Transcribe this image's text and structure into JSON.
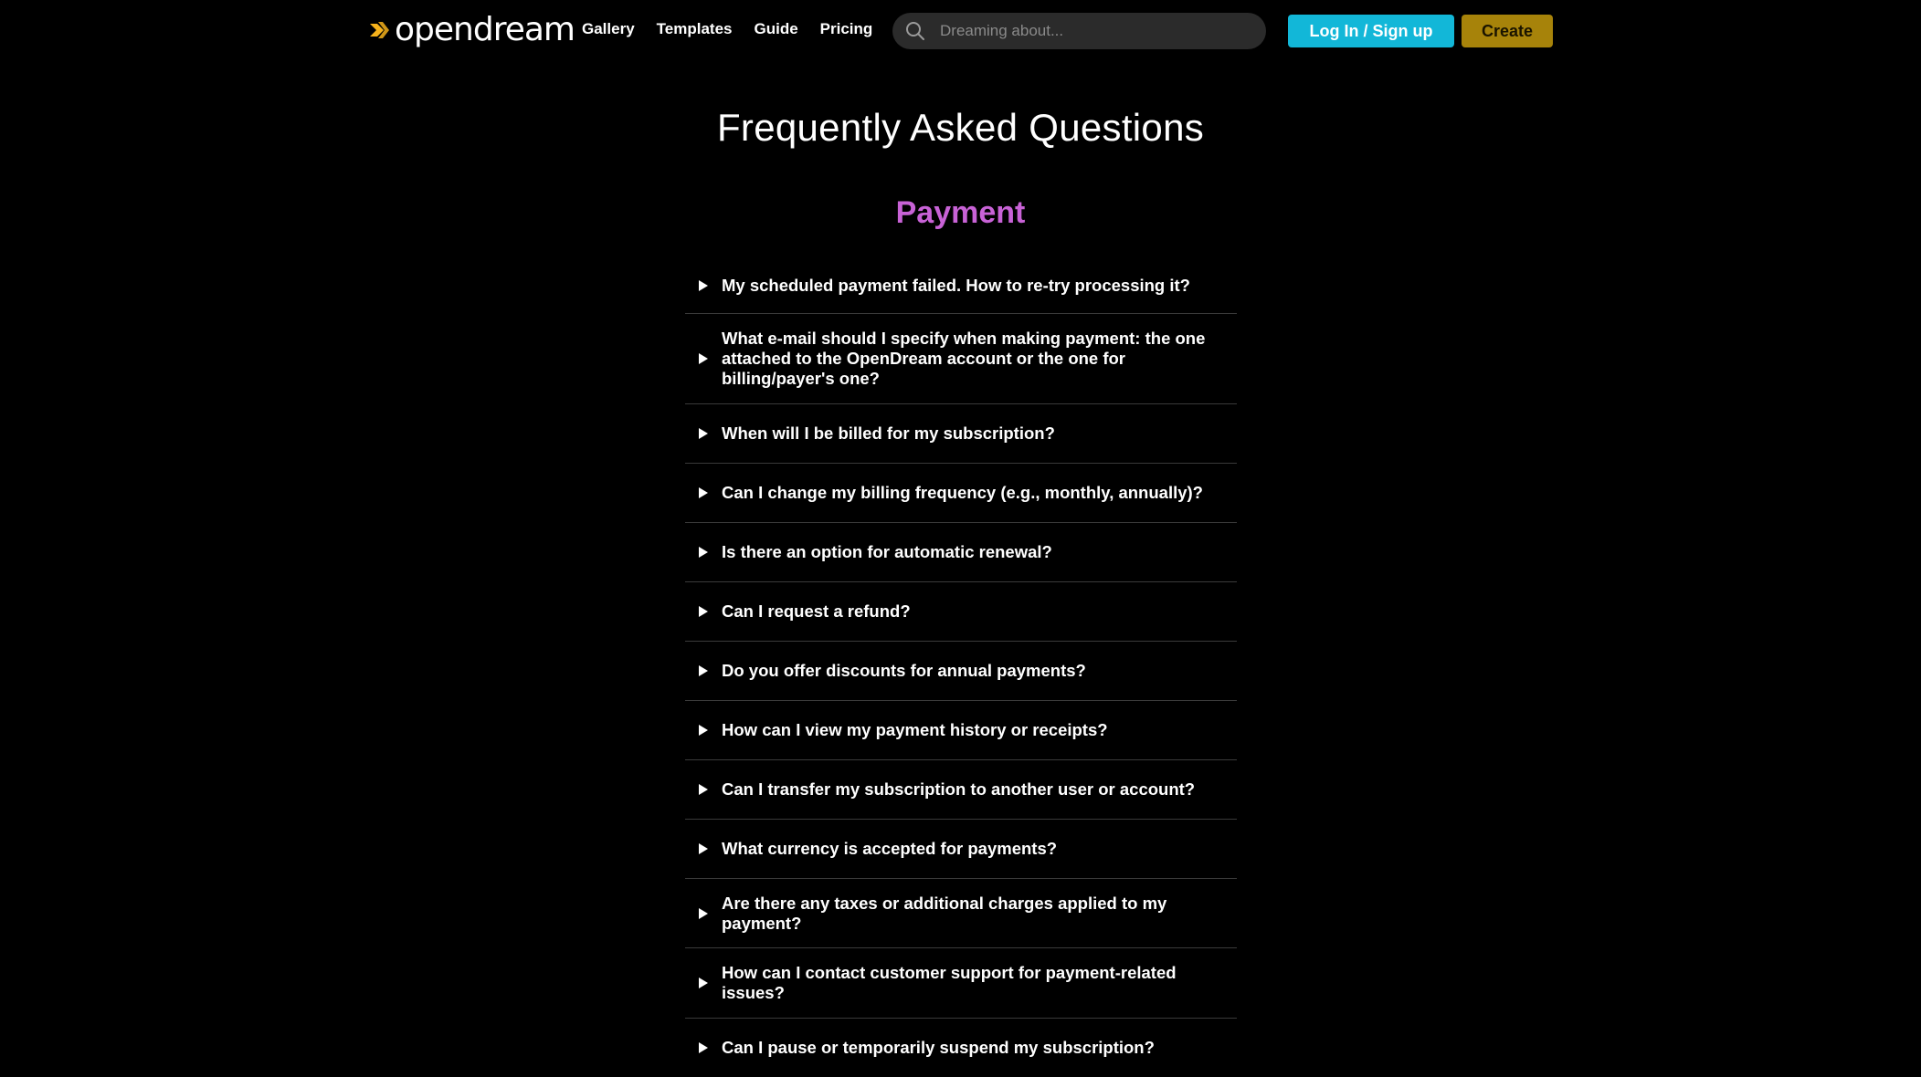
{
  "header": {
    "logo_text": "opendream",
    "logo_accent": "#f6b21b",
    "nav": [
      "Gallery",
      "Templates",
      "Guide",
      "Pricing"
    ],
    "search_placeholder": "Dreaming about...",
    "login_label": "Log In / Sign up",
    "create_label": "Create"
  },
  "main": {
    "title": "Frequently Asked Questions",
    "section": "Payment",
    "section_color": "#c862d6",
    "questions": [
      "My scheduled payment failed. How to re-try processing it?",
      "What e-mail should I specify when making payment: the one attached to the OpenDream account or the one for billing/payer's one?",
      "When will I be billed for my subscription?",
      "Can I change my billing frequency (e.g., monthly, annually)?",
      "Is there an option for automatic renewal?",
      "Can I request a refund?",
      "Do you offer discounts for annual payments?",
      "How can I view my payment history or receipts?",
      "Can I transfer my subscription to another user or account?",
      "What currency is accepted for payments?",
      "Are there any taxes or additional charges applied to my payment?",
      "How can I contact customer support for payment-related issues?",
      "Can I pause or temporarily suspend my subscription?"
    ]
  }
}
